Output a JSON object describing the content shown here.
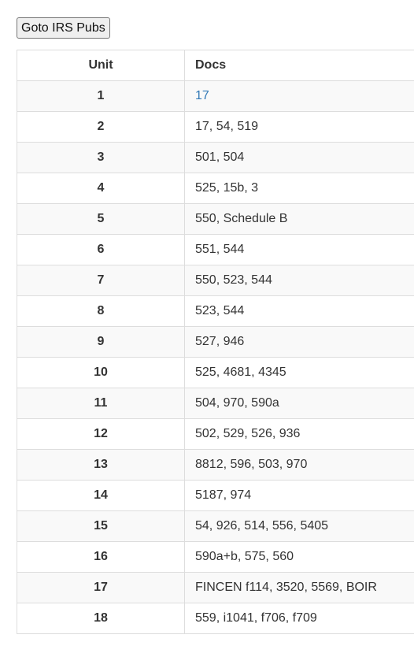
{
  "toolbar": {
    "goto_label": "Goto IRS Pubs"
  },
  "table": {
    "headers": [
      "Unit",
      "Docs"
    ],
    "rows": [
      {
        "unit": "1",
        "docs": "17",
        "is_link": true
      },
      {
        "unit": "2",
        "docs": "17, 54, 519"
      },
      {
        "unit": "3",
        "docs": "501, 504"
      },
      {
        "unit": "4",
        "docs": "525, 15b, 3"
      },
      {
        "unit": "5",
        "docs": "550, Schedule B"
      },
      {
        "unit": "6",
        "docs": "551, 544"
      },
      {
        "unit": "7",
        "docs": "550, 523, 544"
      },
      {
        "unit": "8",
        "docs": "523, 544"
      },
      {
        "unit": "9",
        "docs": "527, 946"
      },
      {
        "unit": "10",
        "docs": "525, 4681, 4345"
      },
      {
        "unit": "11",
        "docs": "504, 970, 590a"
      },
      {
        "unit": "12",
        "docs": "502, 529, 526, 936"
      },
      {
        "unit": "13",
        "docs": "8812, 596, 503, 970"
      },
      {
        "unit": "14",
        "docs": "5187, 974"
      },
      {
        "unit": "15",
        "docs": "54, 926, 514, 556, 5405"
      },
      {
        "unit": "16",
        "docs": "590a+b, 575, 560"
      },
      {
        "unit": "17",
        "docs": "FINCEN f114, 3520, 5569, BOIR"
      },
      {
        "unit": "18",
        "docs": "559, i1041, f706, f709"
      }
    ]
  },
  "colors": {
    "link": "#337ab7",
    "stripe": "#f9f9f9",
    "border": "#dddddd"
  }
}
